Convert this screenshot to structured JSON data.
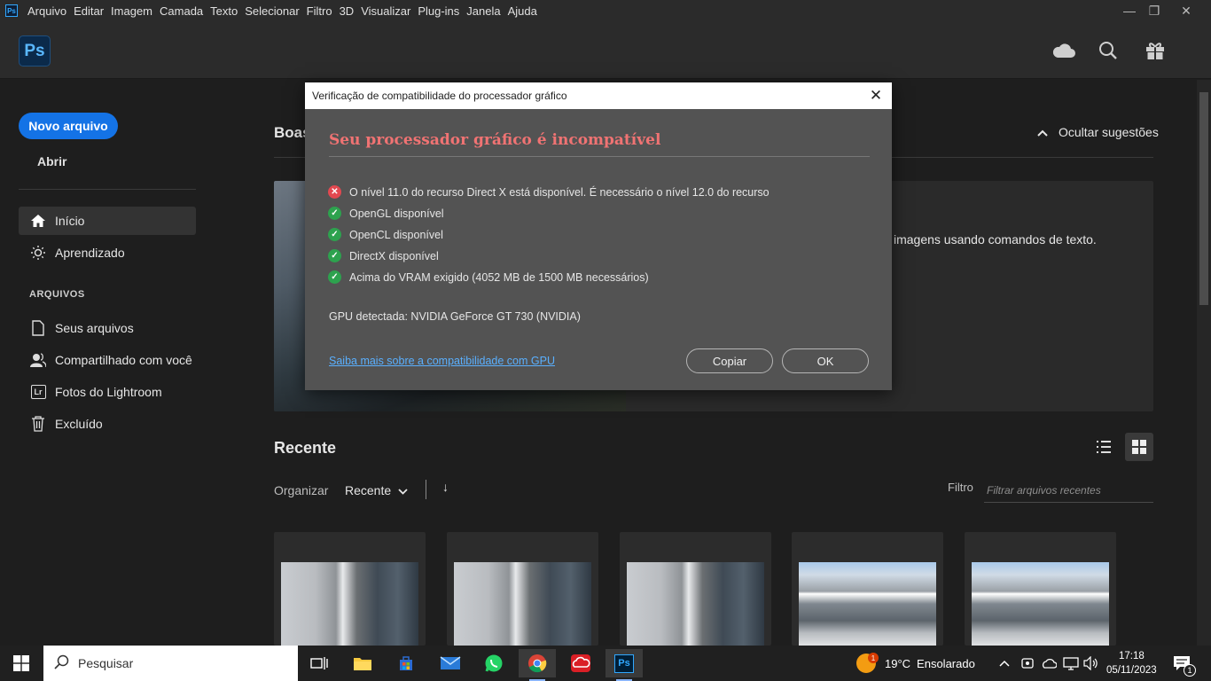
{
  "menubar": {
    "logo": "Ps",
    "items": [
      "Arquivo",
      "Editar",
      "Imagem",
      "Camada",
      "Texto",
      "Selecionar",
      "Filtro",
      "3D",
      "Visualizar",
      "Plug-ins",
      "Janela",
      "Ajuda"
    ]
  },
  "header": {
    "logo": "Ps"
  },
  "sidebar": {
    "new_file": "Novo arquivo",
    "open": "Abrir",
    "nav": [
      {
        "label": "Início",
        "icon": "home-icon"
      },
      {
        "label": "Aprendizado",
        "icon": "lightbulb-icon"
      }
    ],
    "section": "ARQUIVOS",
    "files_nav": [
      {
        "label": "Seus arquivos",
        "icon": "file-icon"
      },
      {
        "label": "Compartilhado com você",
        "icon": "shared-user-icon"
      },
      {
        "label": "Fotos do Lightroom",
        "icon": "lightroom-icon"
      },
      {
        "label": "Excluído",
        "icon": "trash-icon"
      }
    ]
  },
  "main": {
    "welcome": "Boas",
    "hide_tips": "Ocultar sugestões",
    "hero_text": "imagens usando comandos de texto.",
    "recent_title": "Recente",
    "organize": "Organizar",
    "recent_sort": "Recente",
    "filter_label": "Filtro",
    "filter_placeholder": "Filtrar arquivos recentes"
  },
  "dialog": {
    "title": "Verificação de compatibilidade do processador gráfico",
    "heading": "Seu processador gráfico é incompatível",
    "checks": [
      {
        "status": "error",
        "text": "O nível 11.0 do recurso Direct X está disponível. É necessário o nível 12.0 do recurso"
      },
      {
        "status": "ok",
        "text": "OpenGL disponível"
      },
      {
        "status": "ok",
        "text": "OpenCL disponível"
      },
      {
        "status": "ok",
        "text": "DirectX disponível"
      },
      {
        "status": "ok",
        "text": "Acima do VRAM exigido (4052 MB de 1500 MB necessários)"
      }
    ],
    "gpu": "GPU detectada: NVIDIA GeForce GT 730 (NVIDIA)",
    "link": "Saiba mais sobre a compatibilidade com GPU",
    "copy": "Copiar",
    "ok": "OK"
  },
  "taskbar": {
    "search": "Pesquisar",
    "weather_temp": "19°C",
    "weather_text": "Ensolarado",
    "weather_badge": "1",
    "time": "17:18",
    "date": "05/11/2023",
    "notif_count": "1"
  },
  "colors": {
    "accent": "#1473e6",
    "error": "#e34850",
    "ok": "#2da24e",
    "dialog_heading": "#f07373",
    "link": "#5ab0ff"
  }
}
